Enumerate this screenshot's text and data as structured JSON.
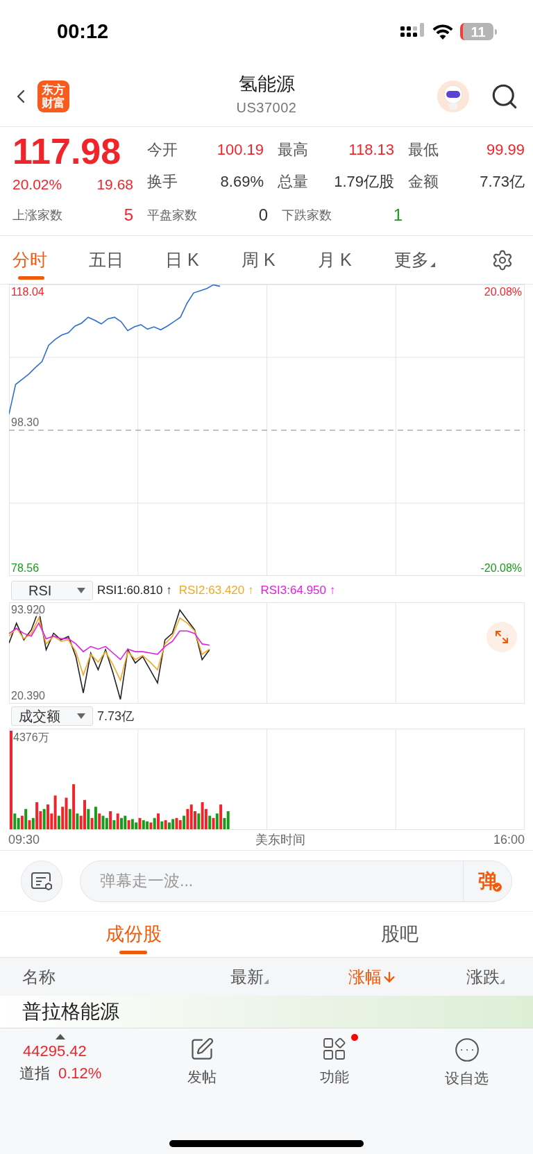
{
  "status_bar": {
    "time": "00:12",
    "battery": "11"
  },
  "header": {
    "logo": [
      "东方",
      "财富"
    ],
    "title": "氢能源",
    "code": "US37002"
  },
  "quote": {
    "price": "117.98",
    "change_pct": "20.02%",
    "change": "19.68",
    "color": "#f0252b",
    "stats": [
      {
        "label": "今开",
        "value": "100.19",
        "color": "#f0252b"
      },
      {
        "label": "最高",
        "value": "118.13",
        "color": "#f0252b"
      },
      {
        "label": "最低",
        "value": "99.99",
        "color": "#f0252b"
      },
      {
        "label": "换手",
        "value": "8.69%",
        "color": "#333333"
      },
      {
        "label": "总量",
        "value": "1.79亿股",
        "color": "#333333"
      },
      {
        "label": "金额",
        "value": "7.73亿",
        "color": "#333333"
      }
    ],
    "counts": [
      {
        "label": "上涨家数",
        "value": "5",
        "color": "#f0252b"
      },
      {
        "label": "平盘家数",
        "value": "0",
        "color": "#333333"
      },
      {
        "label": "下跌家数",
        "value": "1",
        "color": "#1a9a1a"
      }
    ]
  },
  "chart_tabs": [
    {
      "label": "分时",
      "selected": true,
      "kind": "tab"
    },
    {
      "label": "五日",
      "selected": false,
      "kind": "tab"
    },
    {
      "label": "日 K",
      "selected": false,
      "kind": "tab"
    },
    {
      "label": "周 K",
      "selected": false,
      "kind": "tab"
    },
    {
      "label": "月 K",
      "selected": false,
      "kind": "tab"
    },
    {
      "label": "更多",
      "selected": false,
      "kind": "menu"
    }
  ],
  "price_chart": {
    "left_labels": [
      {
        "label": "118.04",
        "color": "#f0252b"
      },
      {
        "label": "98.30",
        "color": "#666666"
      },
      {
        "label": "78.56",
        "color": "#1a9a1a"
      }
    ],
    "right_labels": [
      {
        "label": "20.08%",
        "color": "#f0252b"
      },
      {
        "label": "-20.08%",
        "color": "#1a9a1a"
      }
    ]
  },
  "indicator": {
    "selector": "RSI",
    "legend": [
      {
        "label": "RSI1:60.810 ↑",
        "color": "#222222"
      },
      {
        "label": "RSI2:63.420 ↑",
        "color": "#f5a623"
      },
      {
        "label": "RSI3:64.950 ↑",
        "color": "#e020e0"
      }
    ],
    "labels": [
      "93.920",
      "20.390"
    ]
  },
  "volume": {
    "selector": "成交额",
    "total": "7.73亿",
    "label": "4376万"
  },
  "time_axis": {
    "start": "09:30",
    "label": "美东时间",
    "end": "16:00"
  },
  "danmaku": {
    "placeholder": "弹幕走一波...",
    "send": "弹"
  },
  "segments": [
    {
      "label": "成份股",
      "selected": true
    },
    {
      "label": "股吧",
      "selected": false
    }
  ],
  "table": {
    "columns": [
      {
        "label": "名称",
        "kind": "plain",
        "selected": false
      },
      {
        "label": "最新",
        "kind": "sortable",
        "selected": false
      },
      {
        "label": "涨幅",
        "kind": "sortable",
        "selected": true
      },
      {
        "label": "涨跌",
        "kind": "sortable",
        "selected": false
      }
    ],
    "rows": [
      {
        "name": "普拉格能源"
      }
    ]
  },
  "index_ticker": {
    "value": "44295.42",
    "name": "道指",
    "change": "0.12%",
    "color": "#f0252b"
  },
  "nav": [
    {
      "label": "发帖",
      "kind": "post",
      "badge": false
    },
    {
      "label": "功能",
      "kind": "apps",
      "badge": true
    },
    {
      "label": "设自选",
      "kind": "more",
      "badge": false
    }
  ]
}
